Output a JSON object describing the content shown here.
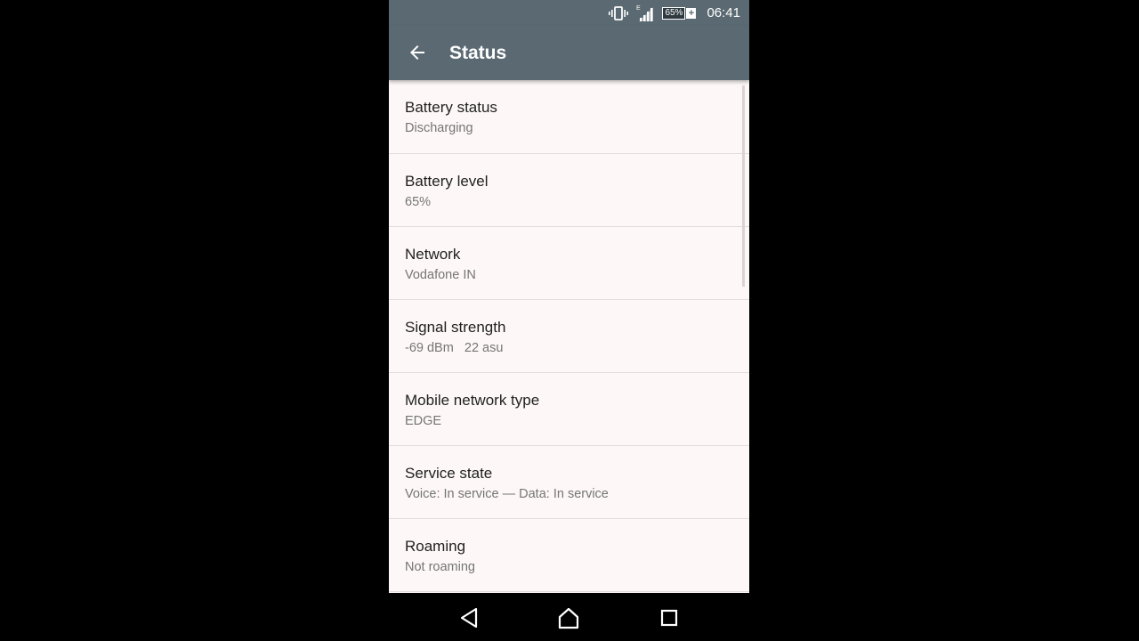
{
  "status_bar": {
    "time": "06:41",
    "battery_percent": "65%",
    "network_indicator": "E",
    "icons": [
      "vibrate-icon",
      "signal-icon",
      "battery-icon"
    ]
  },
  "toolbar": {
    "title": "Status",
    "back_icon": "arrow-back-icon"
  },
  "items": [
    {
      "title": "Battery status",
      "summary": "Discharging"
    },
    {
      "title": "Battery level",
      "summary": "65%"
    },
    {
      "title": "Network",
      "summary": "Vodafone IN"
    },
    {
      "title": "Signal strength",
      "summary": "-69 dBm   22 asu"
    },
    {
      "title": "Mobile network type",
      "summary": "EDGE"
    },
    {
      "title": "Service state",
      "summary": "Voice: In service — Data: In service"
    },
    {
      "title": "Roaming",
      "summary": "Not roaming"
    }
  ],
  "navbar": {
    "buttons": [
      "back",
      "home",
      "recents"
    ]
  },
  "colors": {
    "toolbar": "#5b6a72",
    "background": "#fdf8f7",
    "title_text": "#212121",
    "summary_text": "#757575"
  }
}
